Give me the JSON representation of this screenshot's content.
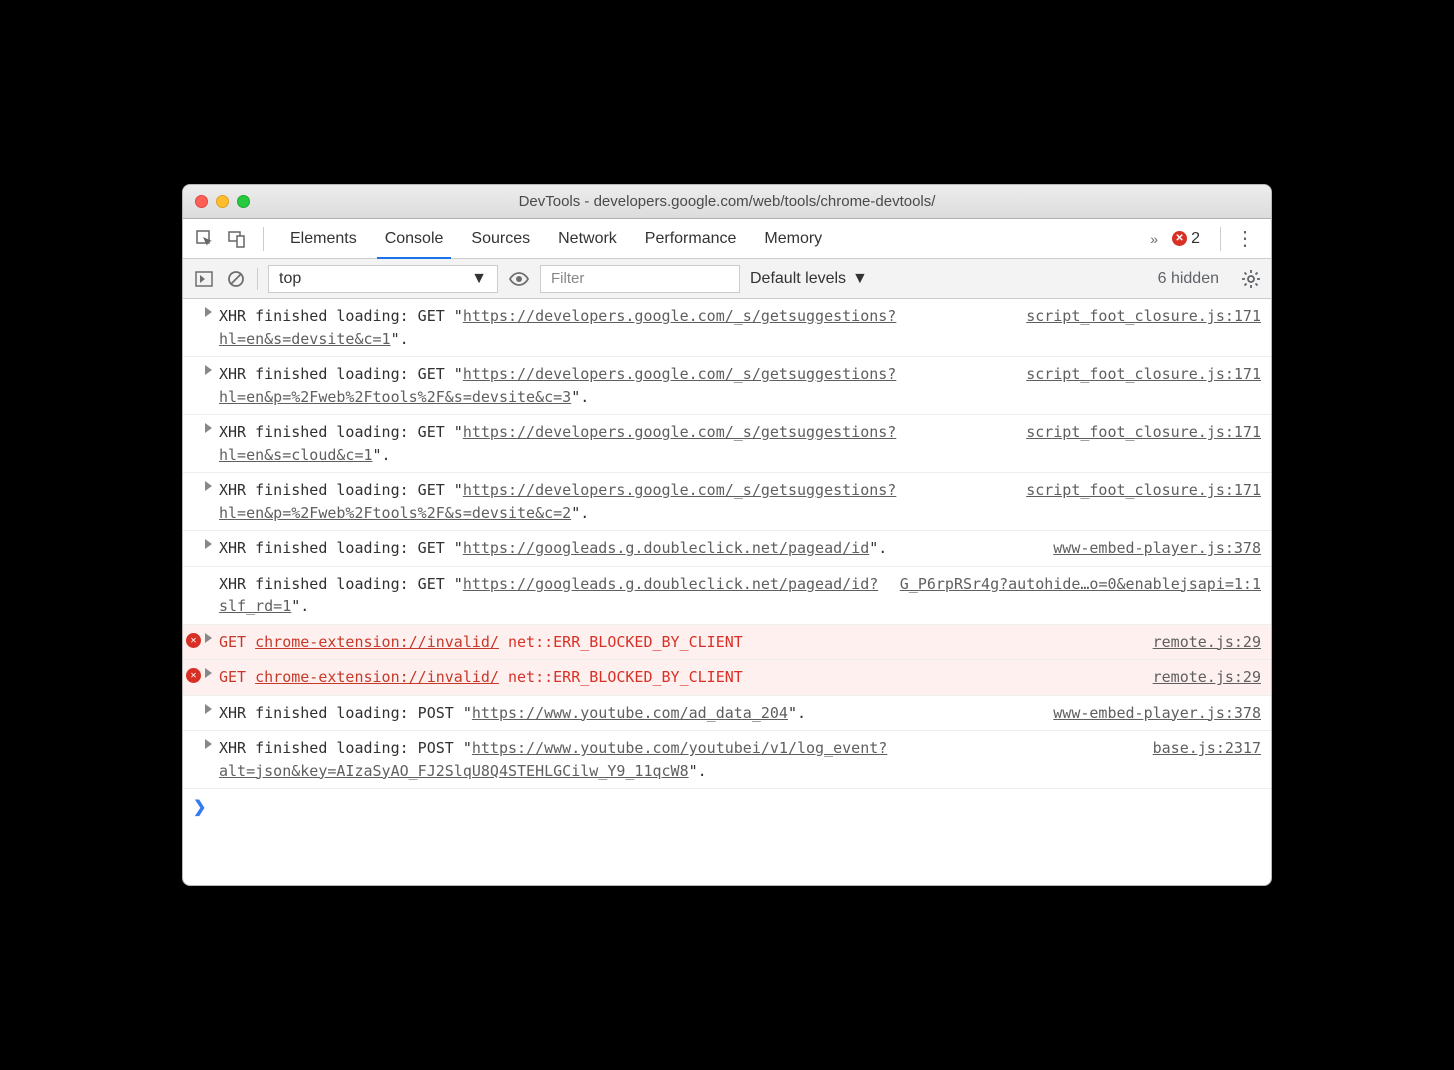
{
  "window": {
    "title": "DevTools - developers.google.com/web/tools/chrome-devtools/"
  },
  "tabs": {
    "items": [
      "Elements",
      "Console",
      "Sources",
      "Network",
      "Performance",
      "Memory"
    ],
    "active_index": 1,
    "error_count": "2"
  },
  "toolbar": {
    "context": "top",
    "filter_placeholder": "Filter",
    "levels": "Default levels",
    "hidden": "6 hidden"
  },
  "messages": [
    {
      "type": "log",
      "expand": true,
      "prefix": "XHR finished loading: GET \"",
      "url": "https://developers.google.com/_s/getsuggestions?hl=en&s=devsite&c=1",
      "suffix": "\".",
      "source": "script_foot_closure.js:171"
    },
    {
      "type": "log",
      "expand": true,
      "prefix": "XHR finished loading: GET \"",
      "url": "https://developers.google.com/_s/getsuggestions?hl=en&p=%2Fweb%2Ftools%2F&s=devsite&c=3",
      "suffix": "\".",
      "source": "script_foot_closure.js:171"
    },
    {
      "type": "log",
      "expand": true,
      "prefix": "XHR finished loading: GET \"",
      "url": "https://developers.google.com/_s/getsuggestions?hl=en&s=cloud&c=1",
      "suffix": "\".",
      "source": "script_foot_closure.js:171"
    },
    {
      "type": "log",
      "expand": true,
      "prefix": "XHR finished loading: GET \"",
      "url": "https://developers.google.com/_s/getsuggestions?hl=en&p=%2Fweb%2Ftools%2F&s=devsite&c=2",
      "suffix": "\".",
      "source": "script_foot_closure.js:171"
    },
    {
      "type": "log",
      "expand": true,
      "prefix": "XHR finished loading: GET \"",
      "url": "https://googleads.g.doubleclick.net/pagead/id",
      "suffix": "\".",
      "source": "www-embed-player.js:378"
    },
    {
      "type": "log",
      "expand": false,
      "prefix": "XHR finished loading: GET \"",
      "url": "https://googleads.g.doubleclick.net/pagead/id?slf_rd=1",
      "suffix": "\".",
      "source": "G_P6rpRSr4g?autohide…o=0&enablejsapi=1:1"
    },
    {
      "type": "error",
      "expand": true,
      "prefix": "GET ",
      "url": "chrome-extension://invalid/",
      "err": " net::ERR_BLOCKED_BY_CLIENT",
      "source": "remote.js:29"
    },
    {
      "type": "error",
      "expand": true,
      "prefix": "GET ",
      "url": "chrome-extension://invalid/",
      "err": " net::ERR_BLOCKED_BY_CLIENT",
      "source": "remote.js:29"
    },
    {
      "type": "log",
      "expand": true,
      "prefix": "XHR finished loading: POST \"",
      "url": "https://www.youtube.com/ad_data_204",
      "suffix": "\".",
      "source": "www-embed-player.js:378"
    },
    {
      "type": "log",
      "expand": true,
      "prefix": "XHR finished loading: POST \"",
      "url": "https://www.youtube.com/youtubei/v1/log_event?alt=json&key=AIzaSyAO_FJ2SlqU8Q4STEHLGCilw_Y9_11qcW8",
      "suffix": "\".",
      "source": "base.js:2317"
    }
  ]
}
